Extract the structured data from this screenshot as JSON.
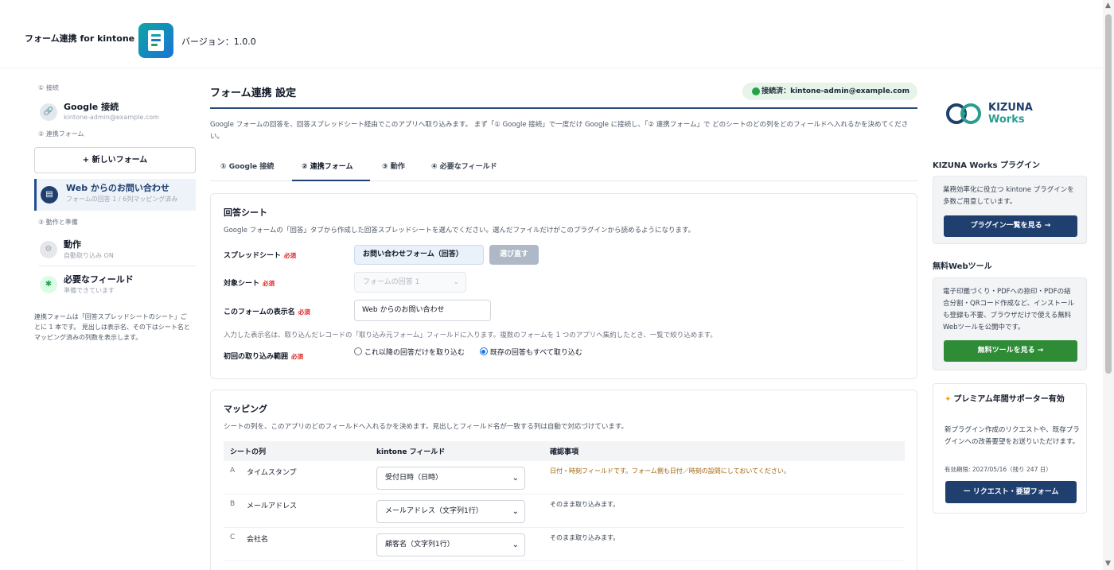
{
  "header": {
    "app_name": "フォーム連携 for kintone",
    "version": "バージョン：1.0.0"
  },
  "left_nav": {
    "section_connection": "① 接続",
    "google": {
      "title": "Google 接続",
      "sub": "kintone-admin@example.com"
    },
    "section_forms": "② 連携フォーム",
    "new_form_label": "+ 新しいフォーム",
    "form_item": {
      "title": "Web からのお問い合わせ",
      "sub": "フォームの回答 1 / 6列マッピング済み"
    },
    "section_behavior": "③ 動作と準備",
    "behavior": {
      "title": "動作",
      "sub": "自動取り込み ON"
    },
    "required_fields": {
      "title": "必要なフィールド",
      "sub": "準備できています"
    },
    "note": "連携フォームは「回答スプレッドシートのシート」ごとに 1 本です。 見出しは表示名、その下はシート名とマッピング済みの列数を表示します。"
  },
  "main": {
    "title": "フォーム連携 設定",
    "connection_badge": "接続済：kintone-admin@example.com",
    "description": "Google フォームの回答を、回答スプレッドシート経由でこのアプリへ取り込みます。 まず「① Google 接続」で一度だけ Google に接続し、「② 連携フォーム」で どのシートのどの列をどのフィールドへ入れるかを決めてください。",
    "tabs": [
      {
        "label": "① Google 接続"
      },
      {
        "label": "② 連携フォーム"
      },
      {
        "label": "③ 動作"
      },
      {
        "label": "④ 必要なフィールド"
      }
    ],
    "active_tab": 1,
    "response_sheet": {
      "title": "回答シート",
      "description": "Google フォームの「回答」タブから作成した回答スプレッドシートを選んでください。選んだファイルだけがこのプラグインから読めるようになります。",
      "required_mark": "必須",
      "spreadsheet_label": "スプレッドシート",
      "spreadsheet_value": "お問い合わせフォーム（回答）",
      "reselect_label": "選び直す",
      "target_sheet_label": "対象シート",
      "target_sheet_value": "フォームの回答 1",
      "display_name_label": "このフォームの表示名",
      "display_name_value": "Web からのお問い合わせ",
      "hint": "入力した表示名は、取り込んだレコードの「取り込み元フォーム」フィールドに入ります。複数のフォームを 1 つのアプリへ集約したとき、一覧で絞り込めます。",
      "initial_range_label": "初回の取り込み範囲",
      "radio_options": [
        "これ以降の回答だけを取り込む",
        "既存の回答もすべて取り込む"
      ],
      "radio_selected": 1
    },
    "mapping": {
      "title": "マッピング",
      "description": "シートの列を、このアプリのどのフィールドへ入れるかを決めます。見出しとフィールド名が一致する列は自動で対応づけています。",
      "headers": {
        "column": "シートの列",
        "field": "kintone フィールド",
        "notes": "確認事項"
      },
      "rows": [
        {
          "letter": "A",
          "name": "タイムスタンプ",
          "field": "受付日時（日時）",
          "note": "日付・時刻フィールドです。フォーム側も日付／時刻の設問にしておいてください。",
          "warn": true
        },
        {
          "letter": "B",
          "name": "メールアドレス",
          "field": "メールアドレス（文字列1行）",
          "note": "そのまま取り込みます。",
          "warn": false
        },
        {
          "letter": "C",
          "name": "会社名",
          "field": "顧客名（文字列1行）",
          "note": "そのまま取り込みます。",
          "warn": false
        }
      ]
    }
  },
  "right": {
    "brand_line1": "KIZUNA",
    "brand_line2": "Works",
    "plugins_heading": "KIZUNA Works プラグイン",
    "plugins_text": "業務効率化に役立つ kintone プラグインを多数ご用意しています。",
    "plugins_button": "プラグイン一覧を見る →",
    "tools_heading": "無料Webツール",
    "tools_text": "電子印鑑づくり・PDFへの捺印・PDFの結合分割・QRコード作成など、インストールも登録も不要、ブラウザだけで使える無料Webツールを公開中です。",
    "tools_button": "無料ツールを見る →",
    "premium_title": "プレミアム年間サポーター有効",
    "premium_text": "新プラグイン作成のリクエストや、既存プラグインへの改善要望をお送りいただけます。",
    "premium_expiry": "有効期限: 2027/05/16（残り 247 日）",
    "premium_button": "ー リクエスト・要望フォーム"
  },
  "colors": {
    "navy": "#1f3f6f",
    "teal": "#2a9d8f",
    "green_button": "#2e8b36",
    "required_red": "#dc2626"
  }
}
